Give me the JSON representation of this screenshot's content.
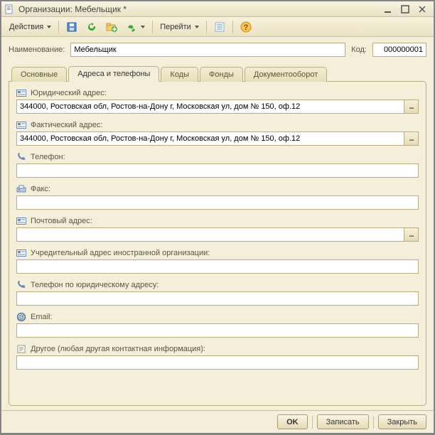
{
  "window": {
    "title": "Организации: Мебельщик *"
  },
  "toolbar": {
    "actions_label": "Действия",
    "goto_label": "Перейти"
  },
  "top": {
    "name_label": "Наименование:",
    "name_value": "Мебельщик",
    "code_label": "Код:",
    "code_value": "000000001"
  },
  "tabs": [
    {
      "label": "Основные"
    },
    {
      "label": "Адреса и телефоны"
    },
    {
      "label": "Коды"
    },
    {
      "label": "Фонды"
    },
    {
      "label": "Документооборот"
    }
  ],
  "active_tab_index": 1,
  "fields": [
    {
      "icon": "address-card-icon",
      "label": "Юридический адрес:",
      "value": "344000, Ростовская обл, Ростов-на-Дону г, Московская ул, дом № 150, оф.12",
      "has_button": true
    },
    {
      "icon": "address-card-icon",
      "label": "Фактический адрес:",
      "value": "344000, Ростовская обл, Ростов-на-Дону г, Московская ул, дом № 150, оф.12",
      "has_button": true
    },
    {
      "icon": "phone-icon",
      "label": "Телефон:",
      "value": "",
      "has_button": false
    },
    {
      "icon": "fax-icon",
      "label": "Факс:",
      "value": "",
      "has_button": false
    },
    {
      "icon": "address-card-icon",
      "label": "Почтовый адрес:",
      "value": "",
      "has_button": true
    },
    {
      "icon": "address-card-icon",
      "label": "Учредительный адрес иностранной организации:",
      "value": "",
      "has_button": false
    },
    {
      "icon": "phone-icon",
      "label": "Телефон по юридическому адресу:",
      "value": "",
      "has_button": false
    },
    {
      "icon": "email-icon",
      "label": "Email:",
      "value": "",
      "has_button": false
    },
    {
      "icon": "note-icon",
      "label": "Другое (любая другая контактная информация):",
      "value": "",
      "has_button": false
    }
  ],
  "footer": {
    "ok_label": "OK",
    "save_label": "Записать",
    "close_label": "Закрыть"
  }
}
